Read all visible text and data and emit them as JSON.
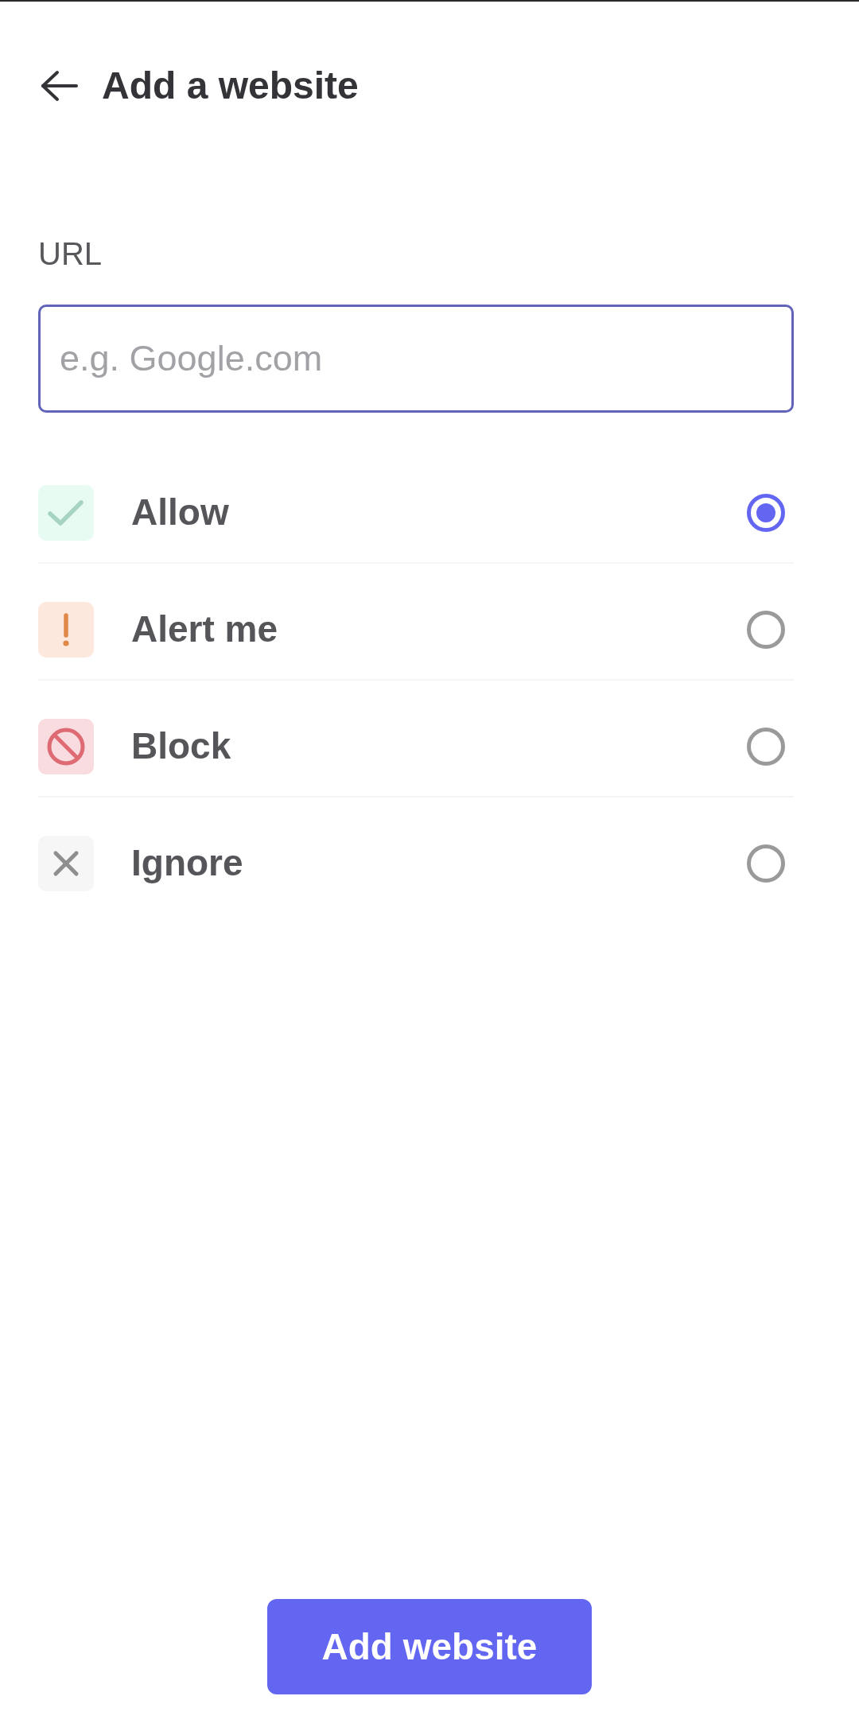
{
  "header": {
    "title": "Add a website"
  },
  "url_field": {
    "label": "URL",
    "placeholder": "e.g. Google.com"
  },
  "options": [
    {
      "kind": "allow",
      "label": "Allow",
      "selected": true
    },
    {
      "kind": "alert",
      "label": "Alert me",
      "selected": false
    },
    {
      "kind": "block",
      "label": "Block",
      "selected": false
    },
    {
      "kind": "ignore",
      "label": "Ignore",
      "selected": false
    }
  ],
  "submit_button": {
    "label": "Add website"
  }
}
